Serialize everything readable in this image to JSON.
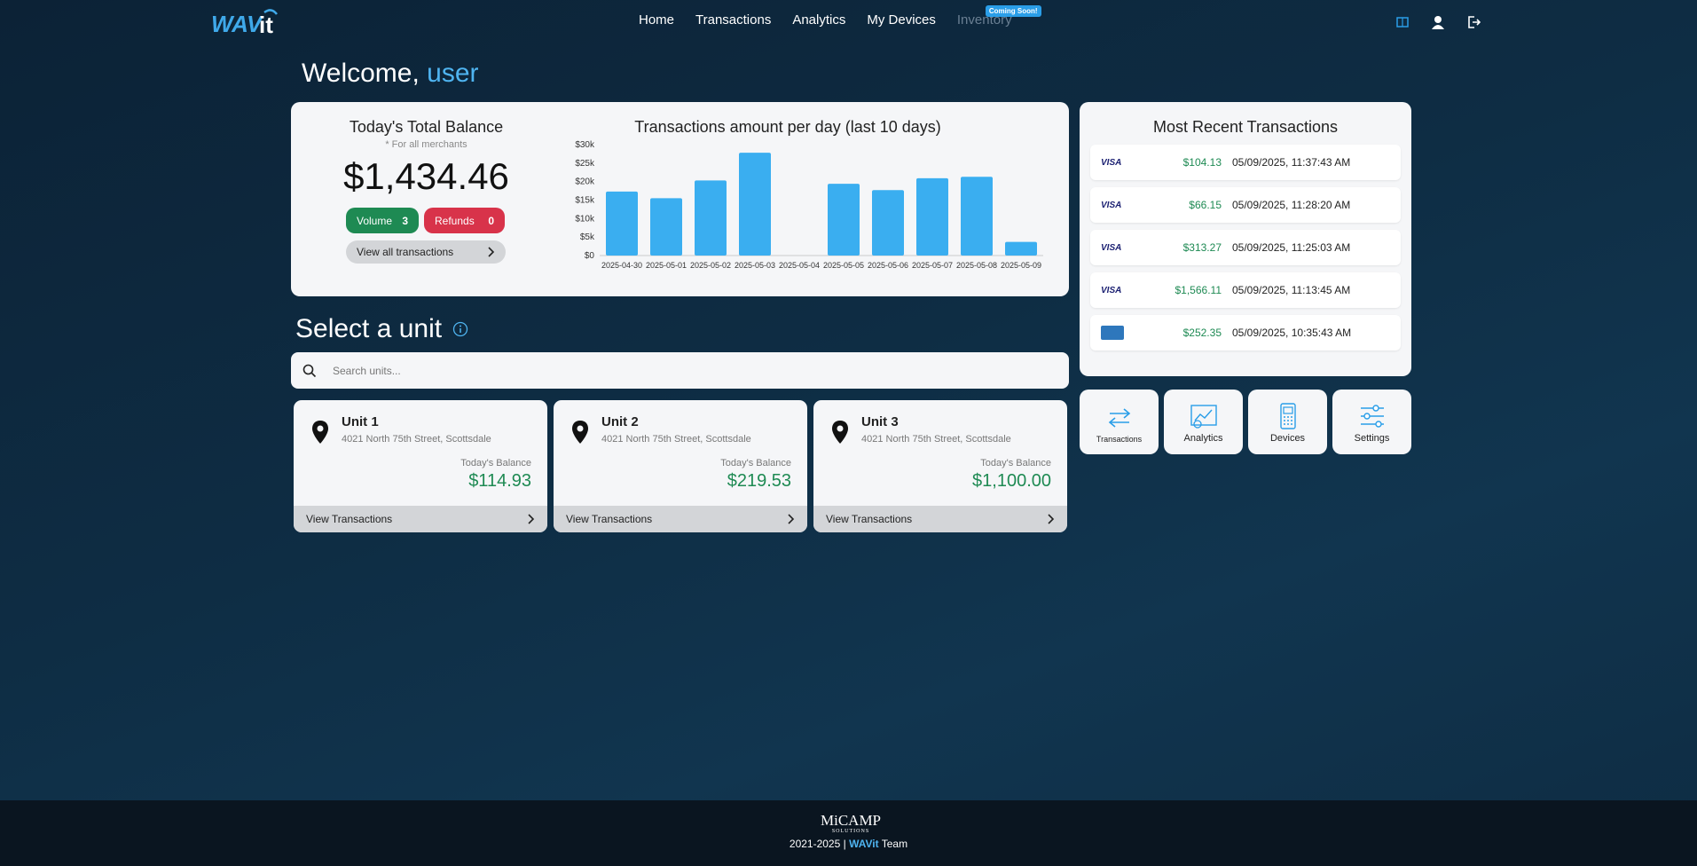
{
  "nav": {
    "logo_text": "WAVit",
    "links": [
      "Home",
      "Transactions",
      "Analytics",
      "My Devices",
      "Inventory"
    ],
    "coming_soon": "Coming Soon!"
  },
  "welcome": {
    "prefix": "Welcome, ",
    "username": "user"
  },
  "balance": {
    "title": "Today's Total Balance",
    "subtitle": "* For all merchants",
    "amount": "$1,434.46",
    "volume_label": "Volume",
    "volume_count": "3",
    "refunds_label": "Refunds",
    "refunds_count": "0",
    "view_all": "View all transactions"
  },
  "chart_data": {
    "type": "bar",
    "title": "Transactions amount per day (last 10 days)",
    "categories": [
      "2025-04-30",
      "2025-05-01",
      "2025-05-02",
      "2025-05-03",
      "2025-05-04",
      "2025-05-05",
      "2025-05-06",
      "2025-05-07",
      "2025-05-08",
      "2025-05-09"
    ],
    "values": [
      17300,
      15500,
      20300,
      27800,
      0,
      19400,
      17700,
      20900,
      21300,
      3700
    ],
    "yticks": [
      "$0",
      "$5k",
      "$10k",
      "$15k",
      "$20k",
      "$25k",
      "$30k"
    ],
    "ylim": [
      0,
      30000
    ],
    "bar_color": "#3aaef0"
  },
  "recent": {
    "title": "Most Recent Transactions",
    "items": [
      {
        "brand": "VISA",
        "amount": "$104.13",
        "date": "05/09/2025, 11:37:43 AM"
      },
      {
        "brand": "VISA",
        "amount": "$66.15",
        "date": "05/09/2025, 11:28:20 AM"
      },
      {
        "brand": "VISA",
        "amount": "$313.27",
        "date": "05/09/2025, 11:25:03 AM"
      },
      {
        "brand": "VISA",
        "amount": "$1,566.11",
        "date": "05/09/2025, 11:13:45 AM"
      },
      {
        "brand": "AMEX",
        "amount": "$252.35",
        "date": "05/09/2025, 10:35:43 AM"
      }
    ]
  },
  "quick_links": [
    "Transactions",
    "Analytics",
    "Devices",
    "Settings"
  ],
  "select_unit": {
    "title": "Select a unit",
    "search_placeholder": "Search units..."
  },
  "units": [
    {
      "name": "Unit 1",
      "address": "4021 North 75th Street, Scottsdale",
      "balance_label": "Today's Balance",
      "balance": "$114.93",
      "link": "View Transactions"
    },
    {
      "name": "Unit 2",
      "address": "4021 North 75th Street, Scottsdale",
      "balance_label": "Today's Balance",
      "balance": "$219.53",
      "link": "View Transactions"
    },
    {
      "name": "Unit 3",
      "address": "4021 North 75th Street, Scottsdale",
      "balance_label": "Today's Balance",
      "balance": "$1,100.00",
      "link": "View Transactions"
    }
  ],
  "footer": {
    "logo": "MiCAMP",
    "logo_sub": "SOLUTIONS",
    "years": "2021-2025 | ",
    "brand": "WAVit",
    "team": " Team"
  },
  "colors": {
    "accent": "#4fb4f0",
    "positive": "#1e8a53",
    "negative": "#d8334a"
  }
}
